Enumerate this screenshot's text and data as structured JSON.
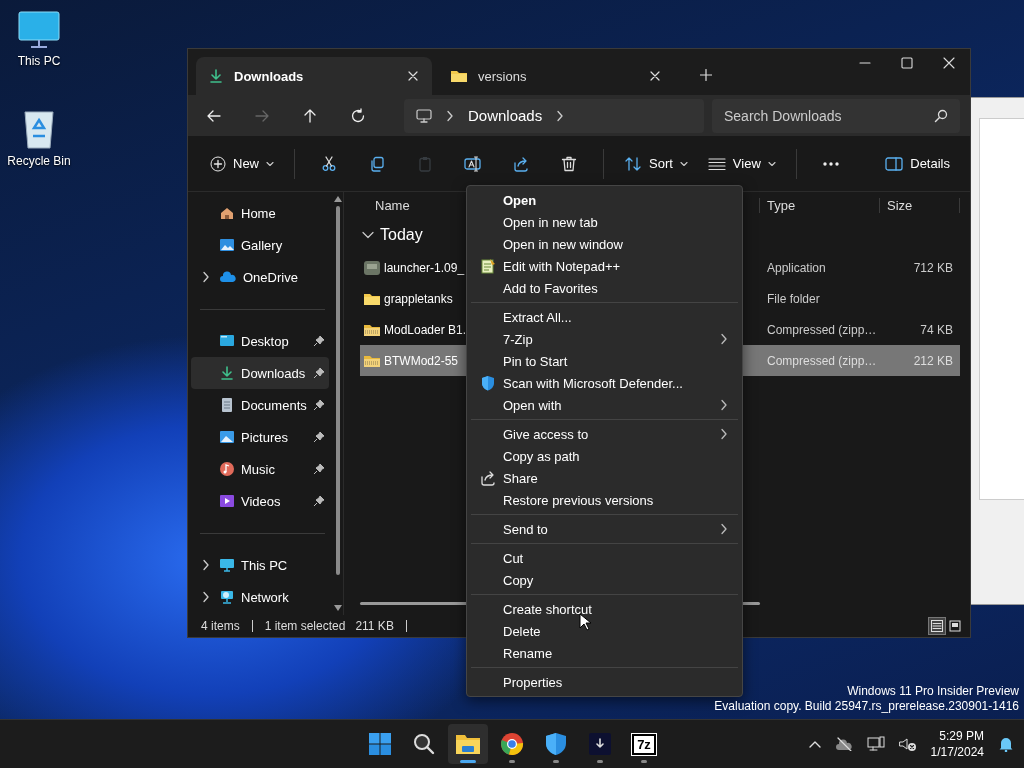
{
  "desktop_icons": [
    {
      "label": "This PC"
    },
    {
      "label": "Recycle Bin"
    }
  ],
  "window": {
    "tabs": [
      {
        "label": "Downloads",
        "selected": true
      },
      {
        "label": "versions",
        "selected": false
      }
    ],
    "address": {
      "crumbs": [
        "Downloads"
      ]
    },
    "search": {
      "placeholder": "Search Downloads"
    },
    "toolbar": [
      {
        "label": "New",
        "dropdown": true,
        "disabled": false
      },
      {
        "dropdown": false,
        "disabled": false
      },
      {
        "dropdown": false,
        "disabled": false
      },
      {
        "dropdown": false,
        "disabled": true
      },
      {
        "dropdown": false,
        "disabled": false
      },
      {
        "dropdown": false,
        "disabled": false
      },
      {
        "dropdown": false,
        "disabled": false
      },
      {
        "label": "Sort",
        "dropdown": true,
        "disabled": false
      },
      {
        "label": "View",
        "dropdown": true,
        "disabled": false
      },
      {
        "dropdown": false,
        "disabled": false
      },
      {
        "label": "Details",
        "dropdown": false,
        "disabled": false
      }
    ],
    "sidebar": {
      "sections": [
        {
          "items": [
            {
              "label": "Home",
              "selected": false,
              "pinned": false
            },
            {
              "label": "Gallery",
              "selected": false,
              "pinned": false
            },
            {
              "label": "OneDrive",
              "selected": false,
              "pinned": false,
              "expanded": false
            }
          ]
        },
        {
          "items": [
            {
              "label": "Desktop",
              "selected": false,
              "pinned": true
            },
            {
              "label": "Downloads",
              "selected": true,
              "pinned": true
            },
            {
              "label": "Documents",
              "selected": false,
              "pinned": true
            },
            {
              "label": "Pictures",
              "selected": false,
              "pinned": true
            },
            {
              "label": "Music",
              "selected": false,
              "pinned": true
            },
            {
              "label": "Videos",
              "selected": false,
              "pinned": true
            }
          ]
        },
        {
          "items": [
            {
              "label": "This PC",
              "selected": false,
              "pinned": false,
              "expanded": false
            },
            {
              "label": "Network",
              "selected": false,
              "pinned": false,
              "expanded": false
            }
          ]
        }
      ]
    },
    "columns": [
      "Name",
      "Type",
      "Size"
    ],
    "group": {
      "label": "Today",
      "expanded": true
    },
    "files": [
      {
        "kind": "app",
        "name": "launcher-1.09_",
        "type": "Application",
        "size": "712 KB",
        "selected": false
      },
      {
        "kind": "folder",
        "name": "grappletanks",
        "type": "File folder",
        "selected": false
      },
      {
        "kind": "zip",
        "name": "ModLoader B1.",
        "type": "Compressed (zipp…",
        "size": "74 KB",
        "selected": false
      },
      {
        "kind": "zip",
        "name": "BTWMod2-55",
        "type": "Compressed (zipp…",
        "size": "212 KB",
        "selected": true
      }
    ],
    "status_bar": {
      "count": "4 items",
      "selection": "1 item selected",
      "size": "211 KB"
    },
    "view_buttons": [
      {
        "selected": true
      },
      {
        "selected": false
      }
    ]
  },
  "context_menu": {
    "groups": [
      [
        {
          "label": "Open",
          "default": true,
          "submenu": false
        },
        {
          "label": "Open in new tab",
          "default": false,
          "submenu": false
        },
        {
          "label": "Open in new window",
          "default": false,
          "submenu": false
        },
        {
          "label": "Edit with Notepad++",
          "default": false,
          "submenu": false
        },
        {
          "label": "Add to Favorites",
          "default": false,
          "submenu": false
        }
      ],
      [
        {
          "label": "Extract All...",
          "default": false,
          "submenu": false
        },
        {
          "label": "7-Zip",
          "default": false,
          "submenu": true
        },
        {
          "label": "Pin to Start",
          "default": false,
          "submenu": false
        },
        {
          "label": "Scan with Microsoft Defender...",
          "default": false,
          "submenu": false
        },
        {
          "label": "Open with",
          "default": false,
          "submenu": true
        }
      ],
      [
        {
          "label": "Give access to",
          "default": false,
          "submenu": true
        },
        {
          "label": "Copy as path",
          "default": false,
          "submenu": false
        },
        {
          "label": "Share",
          "default": false,
          "submenu": false
        },
        {
          "label": "Restore previous versions",
          "default": false,
          "submenu": false
        }
      ],
      [
        {
          "label": "Send to",
          "default": false,
          "submenu": true
        }
      ],
      [
        {
          "label": "Cut",
          "default": false,
          "submenu": false
        },
        {
          "label": "Copy",
          "default": false,
          "submenu": false
        }
      ],
      [
        {
          "label": "Create shortcut",
          "default": false,
          "submenu": false
        },
        {
          "label": "Delete",
          "default": false,
          "submenu": false
        },
        {
          "label": "Rename",
          "default": false,
          "submenu": false
        }
      ],
      [
        {
          "label": "Properties",
          "default": false,
          "submenu": false
        }
      ]
    ]
  },
  "os_notice": [
    "Windows 11 Pro Insider Preview",
    "Evaluation copy. Build 25947.rs_prerelease.230901-1416"
  ],
  "taskbar": {
    "apps": [
      {
        "running": false,
        "active": false
      },
      {
        "running": false,
        "active": false
      },
      {
        "running": true,
        "active": true
      },
      {
        "running": true,
        "active": false
      },
      {
        "running": true,
        "active": false
      },
      {
        "running": true,
        "active": false
      },
      {
        "running": true,
        "active": false,
        "label": "7z"
      }
    ],
    "clock": {
      "time": "5:29 PM",
      "date": "1/17/2024"
    }
  }
}
